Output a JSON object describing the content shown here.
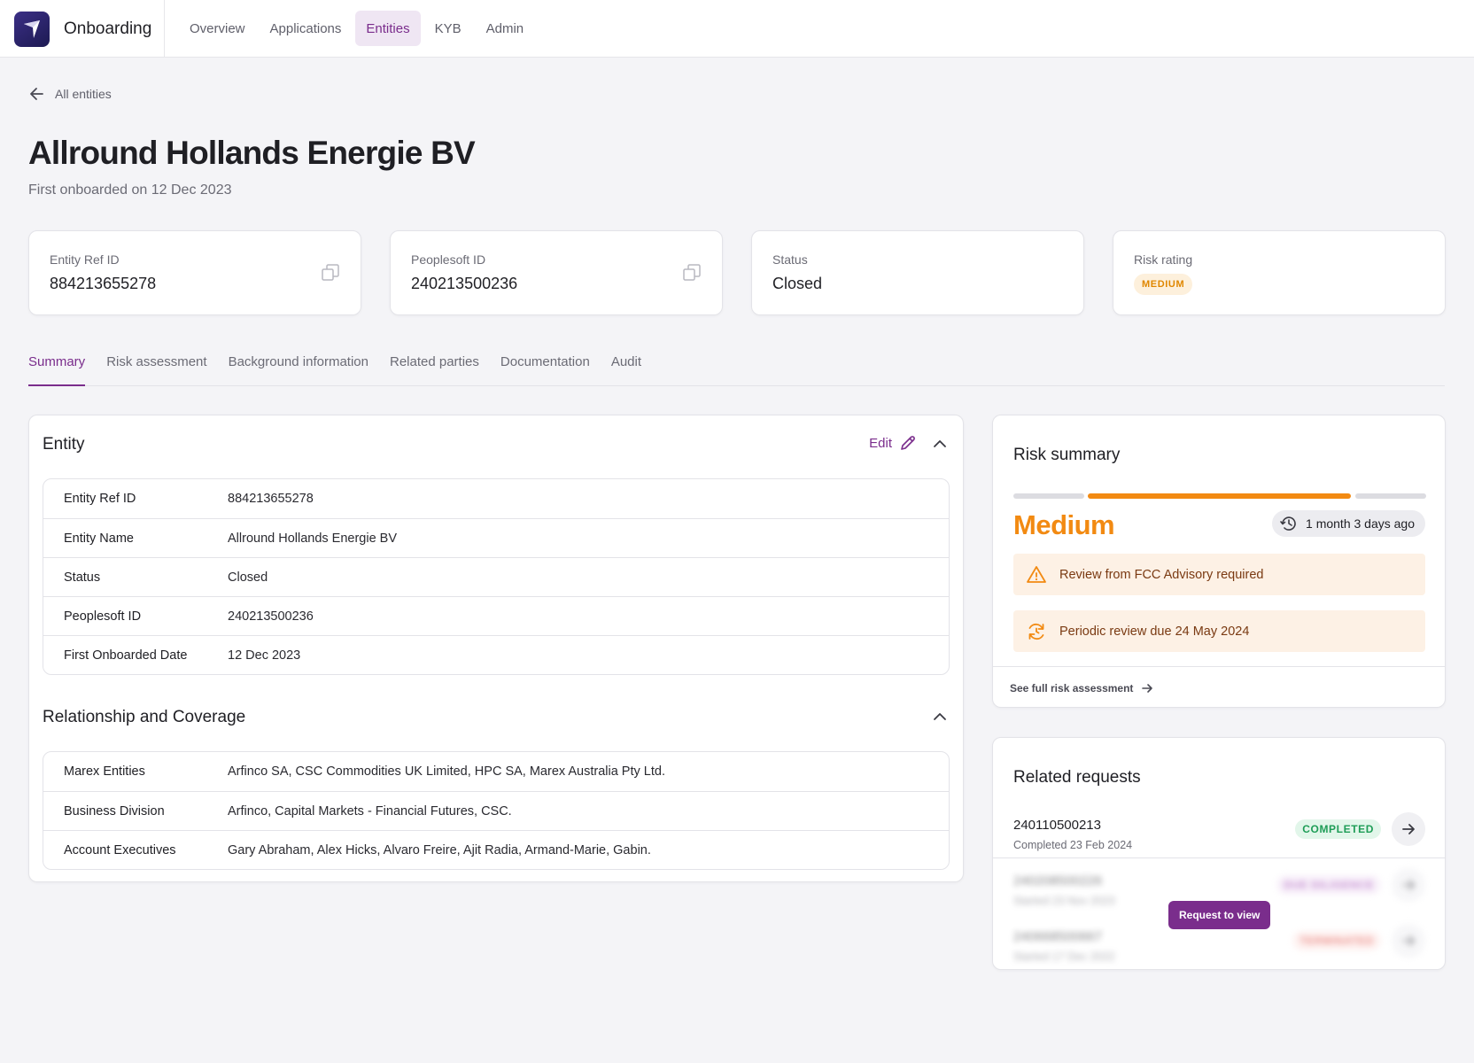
{
  "header": {
    "app_name": "Onboarding",
    "nav": [
      {
        "label": "Overview"
      },
      {
        "label": "Applications"
      },
      {
        "label": "Entities"
      },
      {
        "label": "KYB"
      },
      {
        "label": "Admin"
      }
    ],
    "active_nav": "Entities"
  },
  "back_link": "All entities",
  "page": {
    "title": "Allround Hollands Energie BV",
    "subtitle": "First onboarded on 12 Dec 2023"
  },
  "stats": {
    "entity_ref": {
      "label": "Entity Ref ID",
      "value": "884213655278"
    },
    "peoplesoft": {
      "label": "Peoplesoft ID",
      "value": "240213500236"
    },
    "status": {
      "label": "Status",
      "value": "Closed"
    },
    "risk": {
      "label": "Risk rating",
      "value": "MEDIUM"
    }
  },
  "tabs": [
    "Summary",
    "Risk assessment",
    "Background information",
    "Related parties",
    "Documentation",
    "Audit"
  ],
  "active_tab": "Summary",
  "entity_section": {
    "title": "Entity",
    "edit_label": "Edit",
    "rows": [
      {
        "key": "Entity Ref ID",
        "value": "884213655278"
      },
      {
        "key": "Entity Name",
        "value": "Allround Hollands Energie BV"
      },
      {
        "key": "Status",
        "value": "Closed"
      },
      {
        "key": "Peoplesoft ID",
        "value": "240213500236"
      },
      {
        "key": "First Onboarded Date",
        "value": "12 Dec 2023"
      }
    ]
  },
  "relationship_section": {
    "title": "Relationship and Coverage",
    "rows": [
      {
        "key": "Marex Entities",
        "value": "Arfinco SA, CSC Commodities UK Limited, HPC SA, Marex Australia Pty Ltd."
      },
      {
        "key": "Business Division",
        "value": "Arfinco, Capital Markets - Financial Futures, CSC."
      },
      {
        "key": "Account Executives",
        "value": "Gary Abraham, Alex Hicks, Alvaro Freire, Ajit Radia, Armand-Marie, Gabin."
      }
    ]
  },
  "risk_summary": {
    "title": "Risk summary",
    "level": "Medium",
    "level_index": 2,
    "level_count": 3,
    "level_color": "#f28a12",
    "updated": "1 month 3 days ago",
    "alerts": [
      {
        "icon": "warning-triangle-icon",
        "text": "Review from FCC Advisory required"
      },
      {
        "icon": "refresh-clock-icon",
        "text": "Periodic review due 24 May 2024"
      }
    ],
    "link": "See full risk assessment"
  },
  "related_requests": {
    "title": "Related requests",
    "items": [
      {
        "id": "240110500213",
        "date": "Completed 23 Feb 2024",
        "status": "COMPLETED",
        "status_color": "#1f9d57",
        "status_bg": "#e2f6ea"
      },
      {
        "id": "240208500226",
        "date": "Started 23 Nov 2023",
        "status": "DUE DILIGENCE",
        "status_color": "#9b3bb0",
        "status_bg": "#f3e6f6"
      },
      {
        "id": "240668500667",
        "date": "Started 17 Dec 2022",
        "status": "TERMINATED",
        "status_color": "#e0453c",
        "status_bg": "#fde8e6"
      }
    ],
    "request_button": "Request to view"
  }
}
